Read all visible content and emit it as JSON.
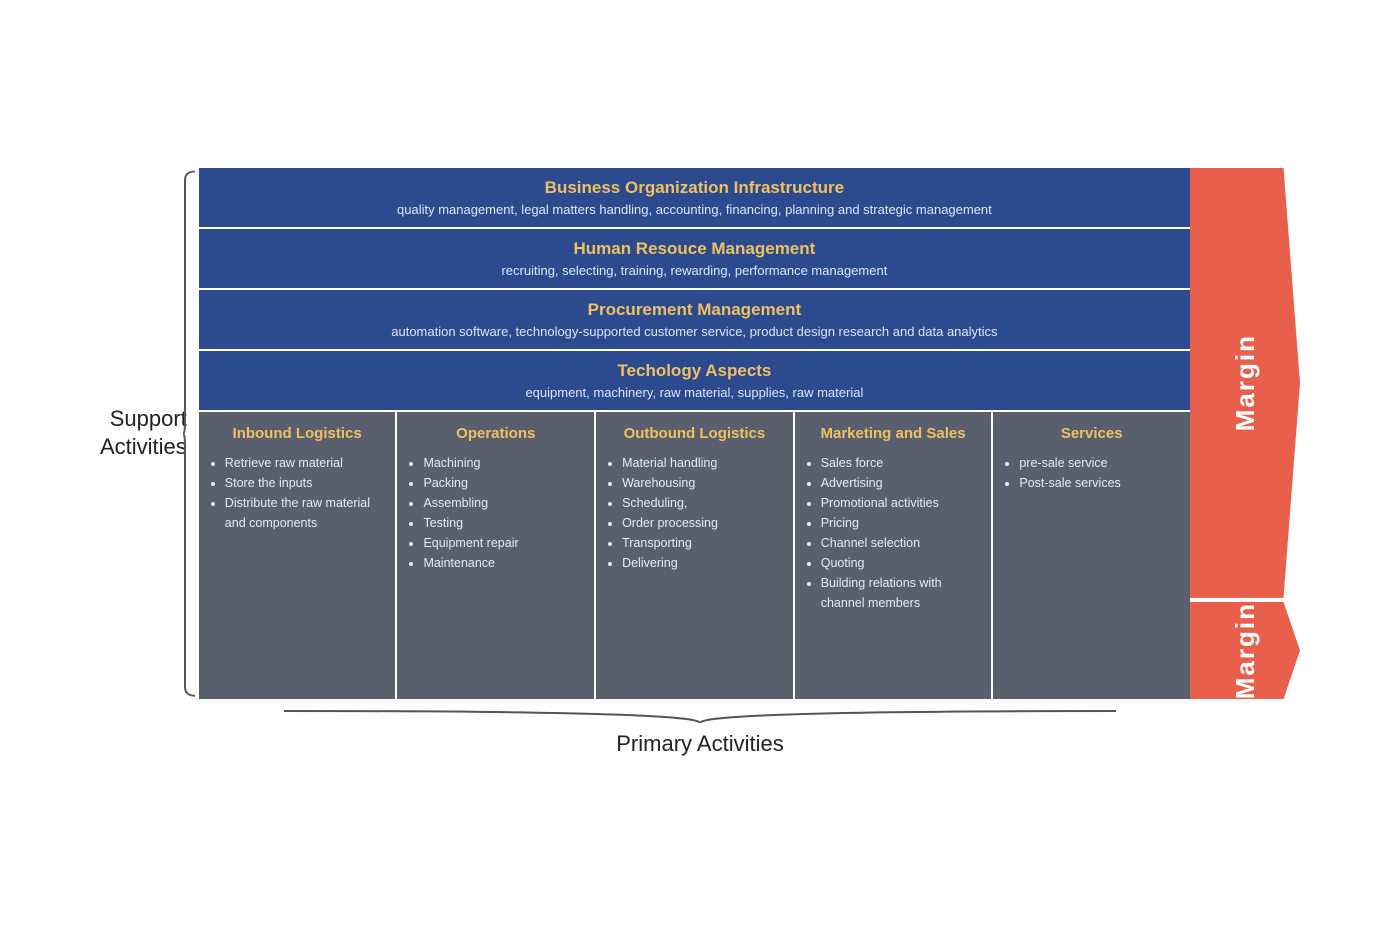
{
  "support": {
    "label_line1": "Support",
    "label_line2": "Activities",
    "rows": [
      {
        "title": "Business Organization Infrastructure",
        "desc": "quality management, legal matters handling, accounting, financing, planning and strategic management"
      },
      {
        "title": "Human Resouce Management",
        "desc": "recruiting, selecting, training, rewarding, performance management"
      },
      {
        "title": "Procurement Management",
        "desc": "automation software, technology-supported customer service, product design research and data analytics"
      },
      {
        "title": "Techology Aspects",
        "desc": "equipment, machinery, raw material, supplies, raw material"
      }
    ]
  },
  "primary": {
    "label": "Primary Activities",
    "columns": [
      {
        "title": "Inbound Logistics",
        "items": [
          "Retrieve raw material",
          "Store the inputs",
          "Distribute the raw material and components"
        ]
      },
      {
        "title": "Operations",
        "items": [
          "Machining",
          "Packing",
          "Assembling",
          "Testing",
          "Equipment repair",
          "Maintenance"
        ]
      },
      {
        "title": "Outbound Logistics",
        "items": [
          "Material handling",
          "Warehousing",
          "Scheduling,",
          "Order processing",
          "Transporting",
          "Delivering"
        ]
      },
      {
        "title": "Marketing and Sales",
        "items": [
          "Sales force",
          "Advertising",
          "Promotional activities",
          "Pricing",
          "Channel selection",
          "Quoting",
          "Building relations with channel members"
        ]
      },
      {
        "title": "Services",
        "items": [
          "pre-sale service",
          "Post-sale services"
        ]
      }
    ]
  },
  "margin": {
    "top_label": "Margin",
    "bottom_label": "Margin"
  }
}
